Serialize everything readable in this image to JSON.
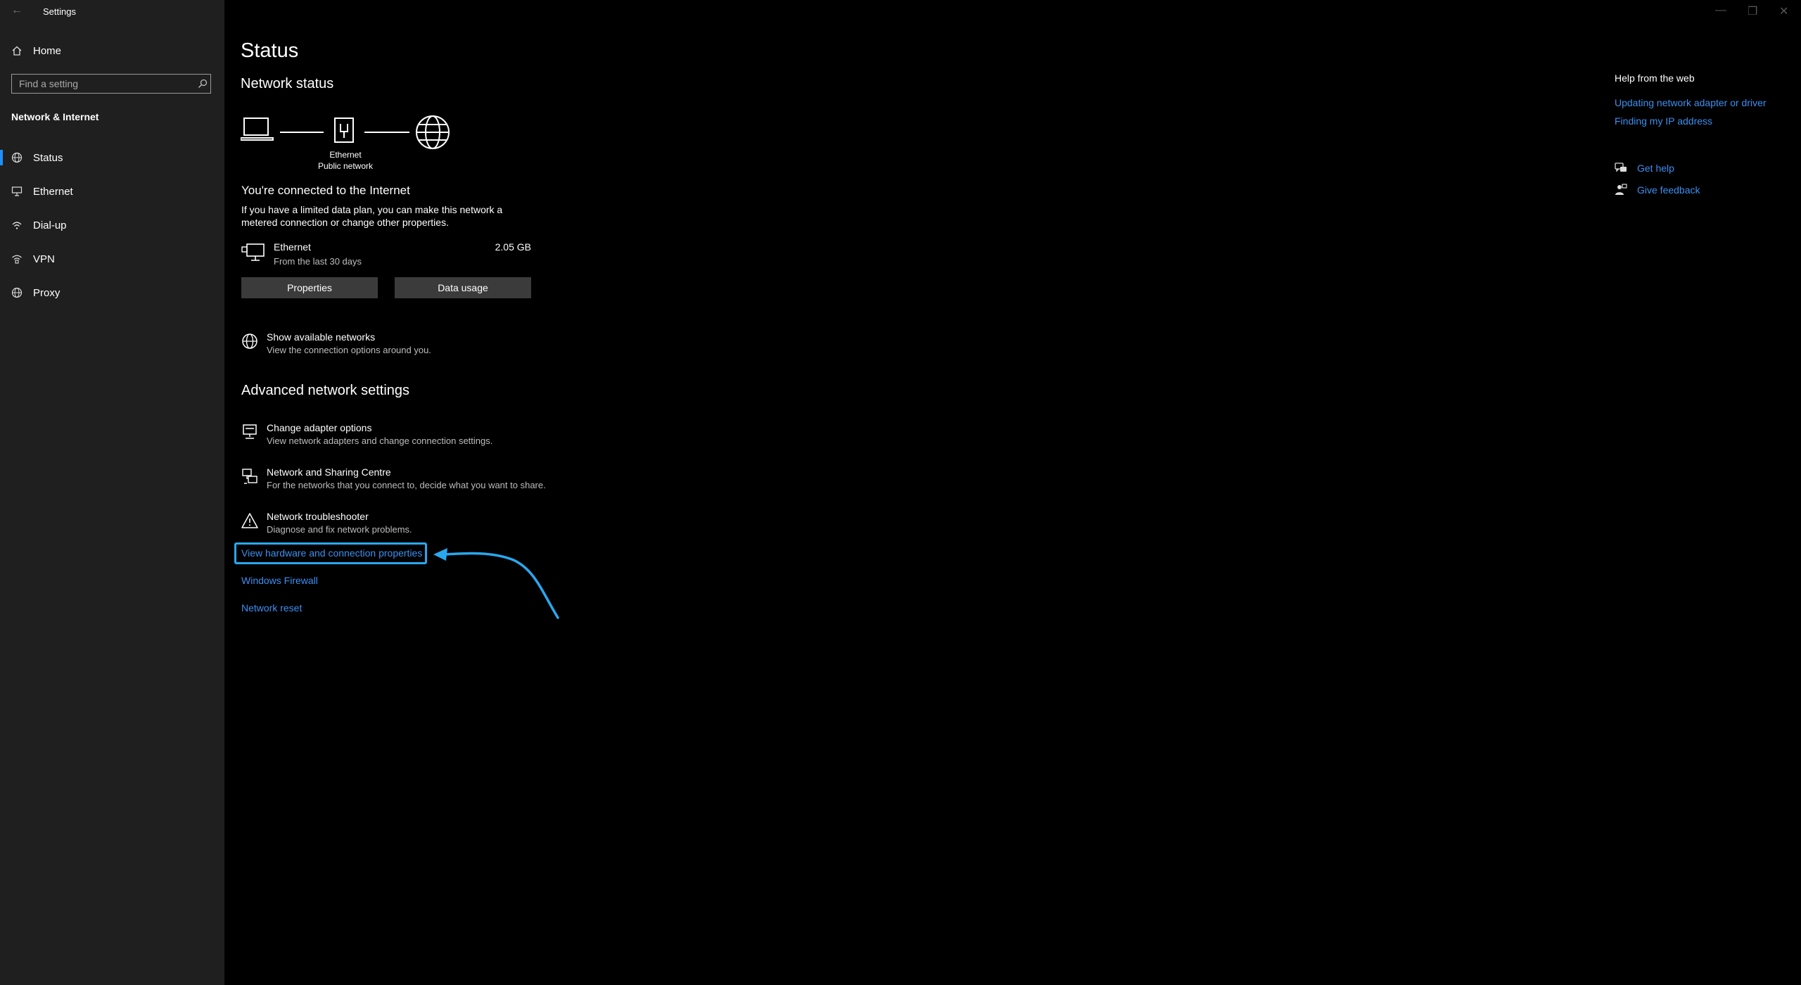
{
  "window": {
    "title": "Settings",
    "back_glyph": "←",
    "controls": {
      "minimize": "—",
      "maximize": "❐",
      "close": "✕"
    }
  },
  "sidebar": {
    "home_label": "Home",
    "search_placeholder": "Find a setting",
    "section_title": "Network & Internet",
    "items": [
      {
        "label": "Status",
        "icon": "status-globe-icon",
        "selected": true
      },
      {
        "label": "Ethernet",
        "icon": "ethernet-icon",
        "selected": false
      },
      {
        "label": "Dial-up",
        "icon": "dialup-icon",
        "selected": false
      },
      {
        "label": "VPN",
        "icon": "vpn-icon",
        "selected": false
      },
      {
        "label": "Proxy",
        "icon": "proxy-globe-icon",
        "selected": false
      }
    ],
    "accent_color": "#1e90ff"
  },
  "main": {
    "page_title": "Status",
    "network_status": {
      "heading": "Network status",
      "adapter_name": "Ethernet",
      "network_type": "Public network"
    },
    "connected": {
      "heading": "You're connected to the Internet",
      "desc_line1": "If you have a limited data plan, you can make this network a",
      "desc_line2": "metered connection or change other properties."
    },
    "usage": {
      "name": "Ethernet",
      "period": "From the last 30 days",
      "amount": "2.05 GB"
    },
    "buttons": {
      "properties": "Properties",
      "data_usage": "Data usage"
    },
    "show_networks": {
      "title": "Show available networks",
      "desc": "View the connection options around you."
    },
    "advanced": {
      "heading": "Advanced network settings",
      "items": [
        {
          "title": "Change adapter options",
          "desc": "View network adapters and change connection settings."
        },
        {
          "title": "Network and Sharing Centre",
          "desc": "For the networks that you connect to, decide what you want to share."
        },
        {
          "title": "Network troubleshooter",
          "desc": "Diagnose and fix network problems."
        }
      ]
    },
    "links": {
      "view_hardware": "View hardware and connection properties",
      "firewall": "Windows Firewall",
      "reset": "Network reset"
    },
    "link_color": "#3c8ff0",
    "annotation_color": "#29a8ef"
  },
  "help": {
    "heading": "Help from the web",
    "links": [
      "Updating network adapter or driver",
      "Finding my IP address"
    ],
    "get_help": "Get help",
    "give_feedback": "Give feedback"
  }
}
